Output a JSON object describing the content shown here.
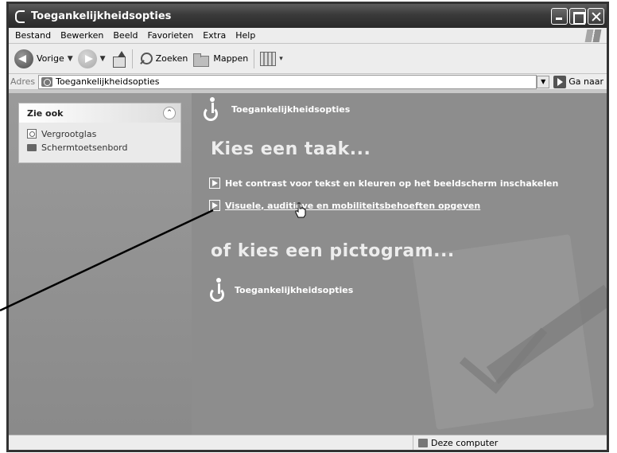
{
  "window": {
    "title": "Toegankelijkheidsopties"
  },
  "menu": [
    "Bestand",
    "Bewerken",
    "Beeld",
    "Favorieten",
    "Extra",
    "Help"
  ],
  "toolbar": {
    "back_label": "Vorige",
    "search_label": "Zoeken",
    "folders_label": "Mappen"
  },
  "address": {
    "label": "Adres",
    "value": "Toegankelijkheidsopties",
    "go_label": "Ga naar"
  },
  "sidebar": {
    "header": "Zie ook",
    "items": [
      "Vergrootglas",
      "Schermtoetsenbord"
    ]
  },
  "main": {
    "header": "Toegankelijkheidsopties",
    "task_heading": "Kies een taak...",
    "tasks": [
      "Het contrast voor tekst en kleuren op het beeldscherm inschakelen",
      "Visuele, auditieve en mobiliteitsbehoeften opgeven"
    ],
    "icon_heading": "of kies een pictogram...",
    "icons": [
      "Toegankelijkheidsopties"
    ]
  },
  "status": {
    "location": "Deze computer"
  },
  "icons": [
    "app-icon",
    "minimize-icon",
    "maximize-icon",
    "close-icon",
    "windows-logo-icon",
    "back-arrow-icon",
    "forward-arrow-icon",
    "up-folder-icon",
    "search-icon",
    "folders-icon",
    "views-icon",
    "address-folder-icon",
    "go-arrow-icon",
    "collapse-icon",
    "magnifier-icon",
    "keyboard-icon",
    "accessibility-icon",
    "task-arrow-icon",
    "hand-cursor-icon",
    "computer-icon"
  ]
}
